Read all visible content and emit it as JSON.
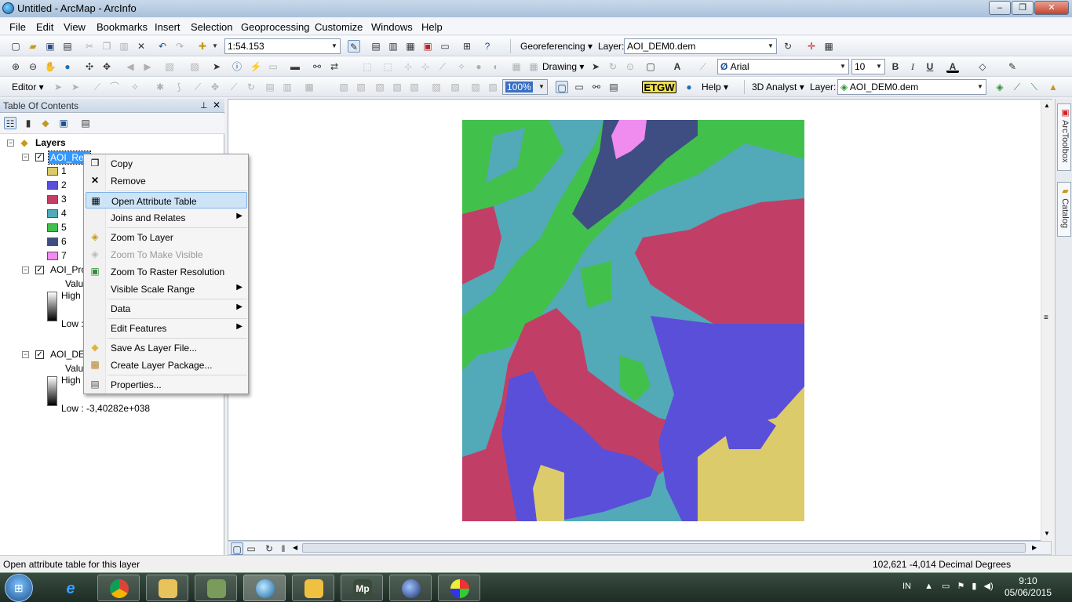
{
  "window": {
    "title": "Untitled - ArcMap - ArcInfo",
    "controls": [
      "–",
      "❐",
      "✕"
    ]
  },
  "menubar": [
    "File",
    "Edit",
    "View",
    "Bookmarks",
    "Insert",
    "Selection",
    "Geoprocessing",
    "Customize",
    "Windows",
    "Help"
  ],
  "standard_toolbar": {
    "scale": "1:54.153",
    "georeferencing_label": "Georeferencing ▾",
    "layer_label": "Layer:",
    "layer_value": "AOI_DEM0.dem"
  },
  "tools_toolbar": {
    "drawing_label": "Drawing ▾",
    "font": "Arial",
    "font_size": "10",
    "bold": "B",
    "italic": "I",
    "underline": "U"
  },
  "editor_toolbar": {
    "editor_label": "Editor ▾",
    "zoom_value": "100%",
    "etgw_label": "ETGW",
    "help_label": "Help ▾",
    "analyst_label": "3D Analyst ▾",
    "layer_label": "Layer:",
    "layer_value": "AOI_DEM0.dem"
  },
  "toc": {
    "title": "Table Of Contents",
    "pin": "⊥",
    "close": "✕",
    "root": "Layers",
    "layer1": {
      "name": "AOI_Rec",
      "classes": [
        {
          "label": "1",
          "color": "#dccb6a"
        },
        {
          "label": "2",
          "color": "#5a4fd8"
        },
        {
          "label": "3",
          "color": "#c13f66"
        },
        {
          "label": "4",
          "color": "#52a9b8"
        },
        {
          "label": "5",
          "color": "#42c04c"
        },
        {
          "label": "6",
          "color": "#3e4e82"
        },
        {
          "label": "7",
          "color": "#f08bf0"
        }
      ]
    },
    "layer2": {
      "name": "AOI_Pro",
      "value": "Valu",
      "high": "High",
      "low": "Low :"
    },
    "layer3": {
      "name": "AOI_DEI",
      "value": "Valu",
      "high": "High",
      "low": "Low : -3,40282e+038"
    }
  },
  "context_menu": {
    "items": [
      {
        "label": "Copy",
        "icon": "copy-icon",
        "glyph": "❐"
      },
      {
        "label": "Remove",
        "icon": "remove-icon",
        "glyph": "✕"
      },
      {
        "label": "Open Attribute Table",
        "icon": "table-icon",
        "glyph": "▦"
      },
      {
        "label": "Joins and Relates",
        "icon": "",
        "glyph": ""
      },
      {
        "label": "Zoom To Layer",
        "icon": "zoom-layer-icon",
        "glyph": "◈"
      },
      {
        "label": "Zoom To Make Visible",
        "icon": "zoom-visible-icon",
        "glyph": "◈"
      },
      {
        "label": "Zoom To Raster Resolution",
        "icon": "raster-resolution-icon",
        "glyph": "▣"
      },
      {
        "label": "Visible Scale Range",
        "icon": "",
        "glyph": ""
      },
      {
        "label": "Data",
        "icon": "",
        "glyph": ""
      },
      {
        "label": "Edit Features",
        "icon": "",
        "glyph": ""
      },
      {
        "label": "Save As Layer File...",
        "icon": "layer-file-icon",
        "glyph": "◆"
      },
      {
        "label": "Create Layer Package...",
        "icon": "layer-package-icon",
        "glyph": "▩"
      },
      {
        "label": "Properties...",
        "icon": "properties-icon",
        "glyph": "▤"
      }
    ],
    "submenu_arrow": "▶"
  },
  "right_dock": {
    "toolbox": "ArcToolbox",
    "catalog": "Catalog"
  },
  "statusbar": {
    "message": "Open attribute table for this layer",
    "coords": "102,621  -4,014 Decimal Degrees"
  },
  "taskbar": {
    "lang": "IN",
    "time": "9:10",
    "date": "05/06/2015",
    "mp_label": "Mp"
  }
}
